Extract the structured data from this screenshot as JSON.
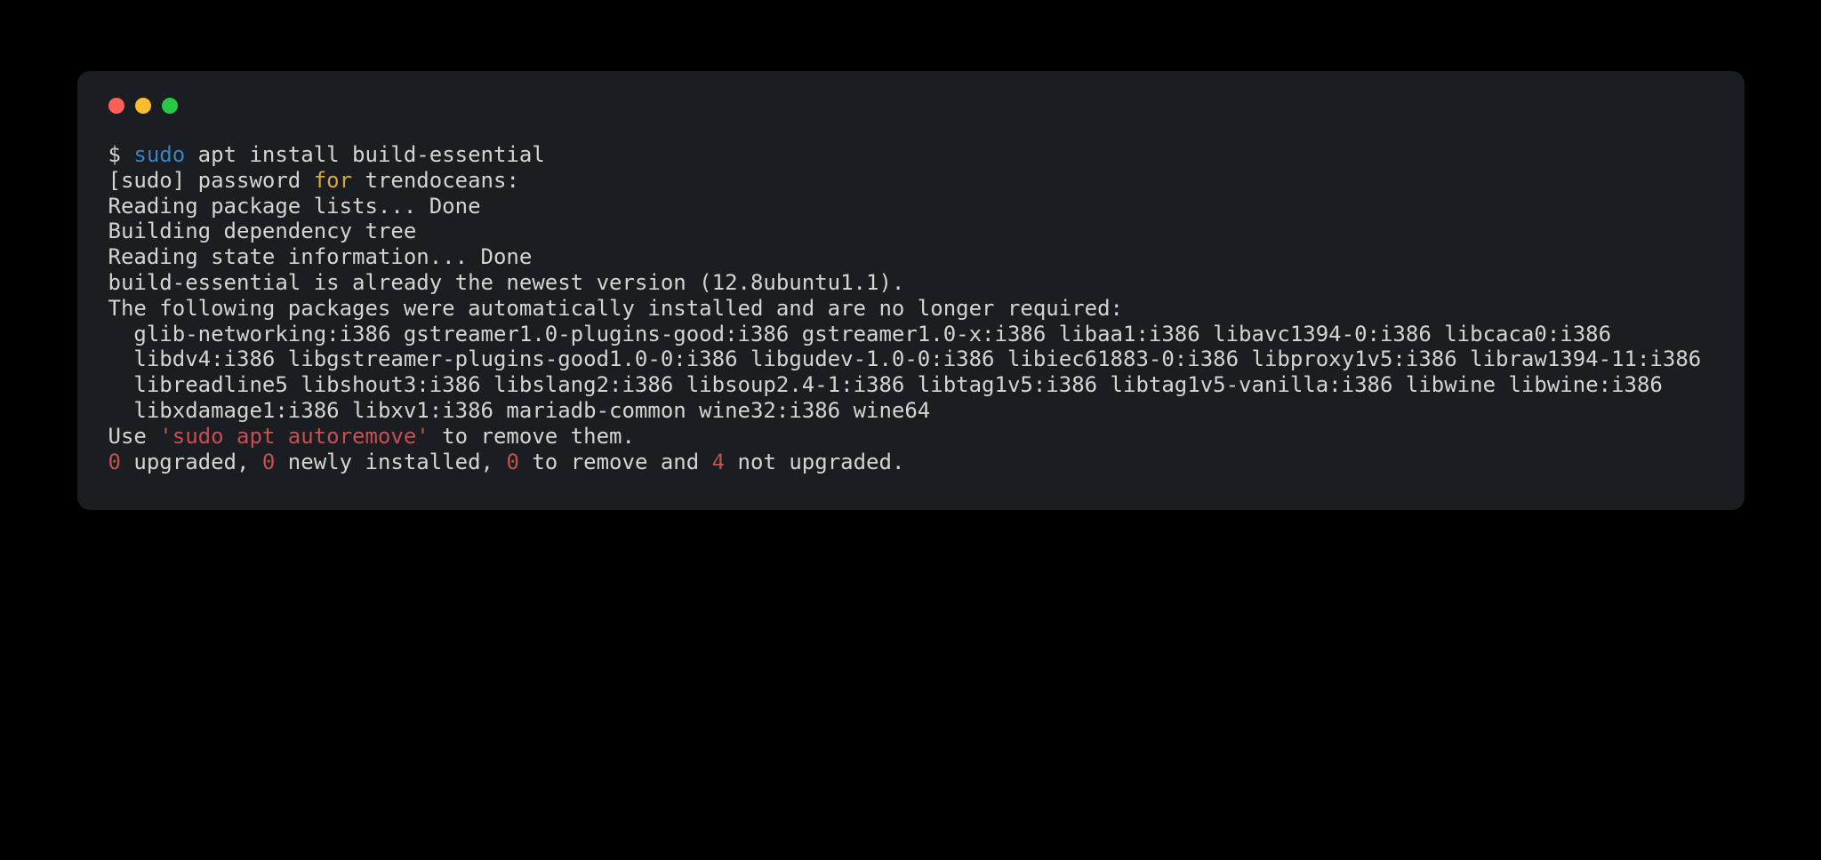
{
  "window": {
    "controls": {
      "close": "close",
      "minimize": "minimize",
      "maximize": "maximize"
    }
  },
  "prompt": {
    "symbol": "$ ",
    "sudo": "sudo",
    "rest": " apt install build-essential"
  },
  "lines": {
    "pwline_pre": "[sudo] password ",
    "pwline_for": "for",
    "pwline_post": " trendoceans:",
    "reading_pkg": "Reading package lists... Done",
    "building_dep": "Building dependency tree",
    "reading_state": "Reading state information... Done",
    "already_newest": "build-essential is already the newest version (12.8ubuntu1.1).",
    "auto_installed": "The following packages were automatically installed and are no longer required:",
    "pkgs1": "  glib-networking:i386 gstreamer1.0-plugins-good:i386 gstreamer1.0-x:i386 libaa1:i386 libavc1394-0:i386 libcaca0:i386",
    "pkgs2": "  libdv4:i386 libgstreamer-plugins-good1.0-0:i386 libgudev-1.0-0:i386 libiec61883-0:i386 libproxy1v5:i386 libraw1394-11:i386",
    "pkgs3": "  libreadline5 libshout3:i386 libslang2:i386 libsoup2.4-1:i386 libtag1v5:i386 libtag1v5-vanilla:i386 libwine libwine:i386",
    "pkgs4": "  libxdamage1:i386 libxv1:i386 mariadb-common wine32:i386 wine64",
    "use_pre": "Use ",
    "use_cmd": "'sudo apt autoremove'",
    "use_post": " to remove them.",
    "summary": {
      "n0a": "0",
      "t1": " upgraded, ",
      "n0b": "0",
      "t2": " newly installed, ",
      "n0c": "0",
      "t3": " to remove and ",
      "n4": "4",
      "t4": " not upgraded."
    }
  }
}
